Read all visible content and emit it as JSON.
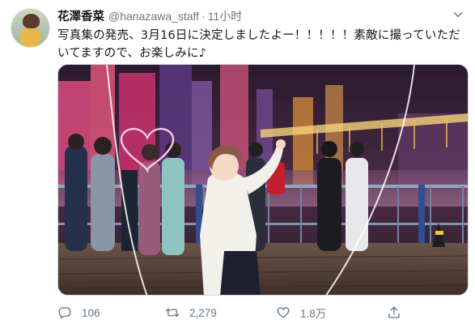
{
  "tweet": {
    "author_name": "花澤香菜",
    "author_handle": "@hanazawa_staff",
    "separator": "·",
    "time": "11小时",
    "text": "写真集の発売、3月16日に決定しましたよー！！！！！素敵に撮っていただいてますので、お楽しみに♪",
    "media_description_icon": "photo",
    "actions": {
      "reply_count": "106",
      "retweet_count": "2,279",
      "like_count": "1.8万"
    }
  },
  "icons": {
    "caret": "chevron-down-icon",
    "reply": "reply-icon",
    "retweet": "retweet-icon",
    "like": "heart-icon",
    "share": "share-icon"
  },
  "colors": {
    "secondary_text": "#657786",
    "primary_text": "#14171a",
    "border": "#ccd6dd"
  }
}
